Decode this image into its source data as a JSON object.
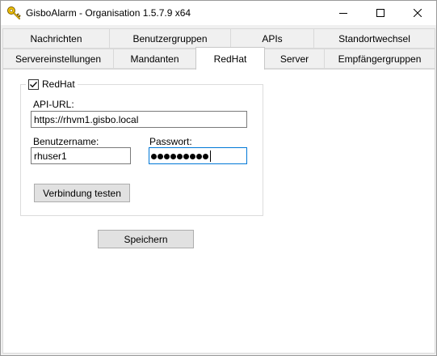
{
  "window": {
    "title": "GisboAlarm - Organisation 1.5.7.9 x64",
    "app_icon": "key-icon",
    "controls": [
      "minimize-icon",
      "maximize-icon",
      "close-icon"
    ]
  },
  "tabs": {
    "row1": [
      "Nachrichten",
      "Benutzergruppen",
      "APIs",
      "Standortwechsel"
    ],
    "row2": [
      "Servereinstellungen",
      "Mandanten",
      "RedHat",
      "Server",
      "Empfängergruppen"
    ],
    "active": "RedHat"
  },
  "redhat": {
    "enabled_label": "RedHat",
    "enabled_checked": true,
    "api_url_label": "API-URL:",
    "api_url_value": "https://rhvm1.gisbo.local",
    "username_label": "Benutzername:",
    "username_value": "rhuser1",
    "password_label": "Passwort:",
    "password_masked_length": 9,
    "test_button": "Verbindung testen"
  },
  "save_button": "Speichern"
}
